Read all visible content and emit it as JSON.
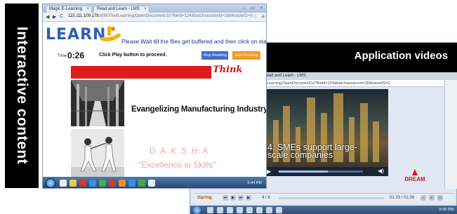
{
  "banner": {
    "text": "Interactive content"
  },
  "video_panel": {
    "header": "Application videos",
    "tab_title": "Read and Learn - LMS",
    "url": "...Learning/OpenDocument/10?fileId=124&batchsessionid=2&ModuleID=0",
    "caption_line1": "4. SMEs support large-",
    "caption_line2": "scale companies",
    "logo_text": "DREAM",
    "player_brand": "iSpring",
    "slide_count": "4 / 6",
    "time_readout": "01:23 / 01:36",
    "progress_fraction": 0.58,
    "clock": "5:45 PM"
  },
  "lms": {
    "tabs": [
      {
        "label": "Magic E-Learning"
      },
      {
        "label": "Read and Learn - LMS"
      }
    ],
    "address": {
      "host": "115.111.109.178",
      "path": ":8080/SelfLearning/OpenDocument/10?fileId=124&batchsessionid=2&ModuleID=0"
    },
    "logo": "LEARN",
    "notice": "Please Wait till the files get buffered and then click on start reading.",
    "time_label": "Time",
    "time_value": "0:26",
    "proceed_text": "Click Play button to proceed.",
    "stop_button": "Stop Reading",
    "start_button": "Start Reading",
    "headline": "Evangelizing Manufacturing Industry",
    "daksha": "D.A.K.S.H.A",
    "excellence": "\"Excellence in Skills\"",
    "think_logo": "Think",
    "clock": "5:44 PM"
  },
  "colors": {
    "accent_blue": "#3d6ed1",
    "accent_orange": "#f39a1f",
    "brand_red": "#e0191b",
    "soft_red_text": "#f1a5a5",
    "notice_blue": "#1a2fa0"
  }
}
